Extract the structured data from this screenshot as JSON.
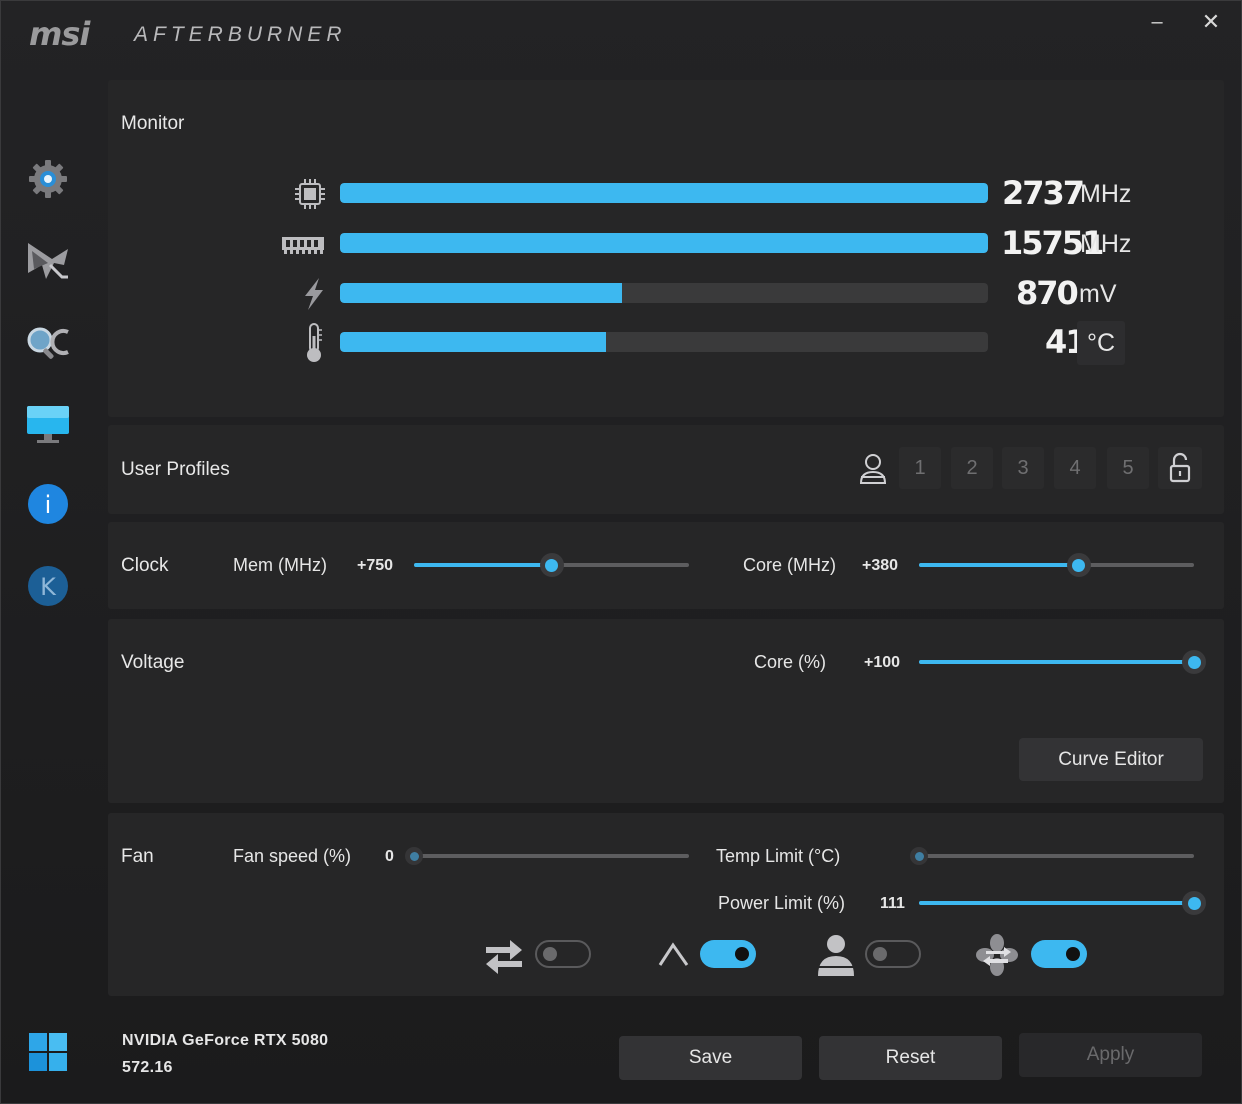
{
  "titlebar": {
    "logo": "msi",
    "title": "AFTERBURNER",
    "minimize_glyph": "–",
    "close_glyph": "✕"
  },
  "sidebar": {
    "items": [
      {
        "icon": "settings-gear-icon"
      },
      {
        "icon": "oc-scanner-icon"
      },
      {
        "icon": "search-monitor-icon"
      },
      {
        "icon": "display-monitor-icon"
      },
      {
        "icon": "info-icon",
        "glyph": "i"
      },
      {
        "icon": "k-icon",
        "glyph": "K"
      }
    ],
    "windows_icon": "windows-logo-icon"
  },
  "monitor": {
    "label": "Monitor",
    "rows": [
      {
        "icon": "gpu-chip-icon",
        "value": "2737",
        "unit": "MHz",
        "fill": 1.0
      },
      {
        "icon": "memory-module-icon",
        "value": "15751",
        "unit": "MHz",
        "fill": 1.0
      },
      {
        "icon": "voltage-bolt-icon",
        "value": "870",
        "unit": "mV",
        "fill": 0.435
      },
      {
        "icon": "thermometer-icon",
        "value": "41",
        "unit": "°C",
        "fill": 0.41
      }
    ]
  },
  "profiles": {
    "label": "User Profiles",
    "slots": [
      "1",
      "2",
      "3",
      "4",
      "5"
    ]
  },
  "clock": {
    "label": "Clock",
    "mem_label": "Mem (MHz)",
    "mem_value": "+750",
    "mem_fraction": 0.5,
    "core_label": "Core (MHz)",
    "core_value": "+380",
    "core_fraction": 0.58
  },
  "voltage": {
    "label": "Voltage",
    "core_label": "Core (%)",
    "core_value": "+100",
    "core_fraction": 1.0,
    "curve_editor": "Curve Editor"
  },
  "fan": {
    "label": "Fan",
    "speed_label": "Fan speed (%)",
    "speed_value": "0",
    "speed_fraction": 0.0,
    "temp_label": "Temp Limit (°C)",
    "temp_fraction": 0.0,
    "power_label": "Power Limit (%)",
    "power_value": "111",
    "power_fraction": 1.0,
    "toggles": [
      {
        "icon": "link-arrows-icon",
        "on": false
      },
      {
        "icon": "auto-a-icon",
        "on": true
      },
      {
        "icon": "user-profile-icon",
        "on": false
      },
      {
        "icon": "fan-sync-icon",
        "on": true
      }
    ]
  },
  "footer": {
    "gpu_name": "NVIDIA GeForce RTX 5080",
    "driver": "572.16",
    "save": "Save",
    "reset": "Reset",
    "apply": "Apply"
  },
  "colors": {
    "accent": "#3db8f0",
    "panel": "#262627",
    "background": "#1c1c1d"
  }
}
